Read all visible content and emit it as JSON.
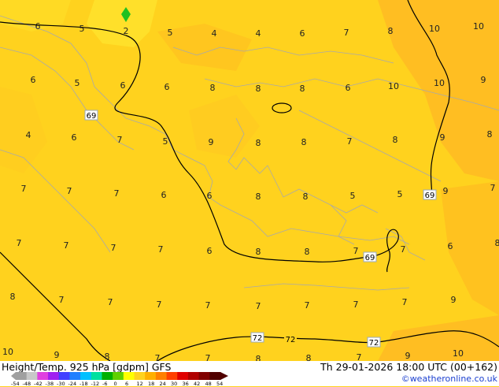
{
  "title": "Height/Temp. 925 hPa [gdpm] GFS",
  "datetime": "Th 29-01-2026 18:00 UTC (00+162)",
  "copyright": "©weatheronline.co.uk",
  "colorbar": {
    "ticks": [
      "-54",
      "-48",
      "-42",
      "-38",
      "-30",
      "-24",
      "-18",
      "-12",
      "-6",
      "0",
      "6",
      "12",
      "18",
      "24",
      "30",
      "36",
      "42",
      "48",
      "54"
    ],
    "colors": [
      "#a0a0a0",
      "#c8c8c8",
      "#e040e0",
      "#a020f0",
      "#4040ff",
      "#2080ff",
      "#00c0ff",
      "#00e0a0",
      "#00b000",
      "#60d000",
      "#ffff00",
      "#ffd21e",
      "#ffb000",
      "#ff8000",
      "#ff4000",
      "#e00000",
      "#b00000",
      "#800000",
      "#500000"
    ]
  },
  "contour_labels": [
    {
      "text": "69",
      "id": "w"
    },
    {
      "text": "69",
      "id": "e"
    },
    {
      "text": "69",
      "id": "s"
    },
    {
      "text": "72",
      "id": "b1"
    },
    {
      "text": "72",
      "id": "b2"
    },
    {
      "text": "72",
      "id": "b3"
    }
  ],
  "temps": [
    "6",
    "5",
    "2",
    "5",
    "4",
    "4",
    "6",
    "7",
    "8",
    "10",
    "10",
    "6",
    "5",
    "6",
    "6",
    "8",
    "8",
    "8",
    "6",
    "10",
    "10",
    "9",
    "4",
    "6",
    "7",
    "5",
    "9",
    "8",
    "8",
    "7",
    "8",
    "9",
    "8",
    "7",
    "7",
    "7",
    "6",
    "6",
    "8",
    "8",
    "5",
    "5",
    "9",
    "7",
    "7",
    "7",
    "7",
    "7",
    "6",
    "8",
    "8",
    "7",
    "7",
    "6",
    "8",
    "8",
    "7",
    "7",
    "7",
    "7",
    "7",
    "7",
    "7",
    "7",
    "9",
    "10",
    "9",
    "8",
    "7",
    "7",
    "8",
    "8",
    "7",
    "9",
    "10"
  ]
}
